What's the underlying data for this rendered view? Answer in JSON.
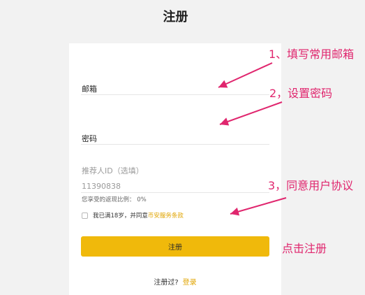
{
  "title": "注册",
  "form": {
    "email_label": "邮箱",
    "password_label": "密码",
    "referrer_label": "推荐人ID（选填）",
    "referrer_value": "11390838",
    "commission_text": "您享受的返现比例： 0%",
    "agree_prefix": "我已满18岁，并同意",
    "terms_link": "币安服务条款",
    "submit_label": "注册",
    "login_prompt": "注册过?",
    "login_link": "登录"
  },
  "annotations": {
    "step1": "1、填写常用邮箱",
    "step2": "2，设置密码",
    "step3": "3，同意用户协议",
    "step4": "点击注册"
  },
  "colors": {
    "accent": "#f0b90b",
    "link": "#e0a400",
    "annotation": "#e0266e"
  }
}
